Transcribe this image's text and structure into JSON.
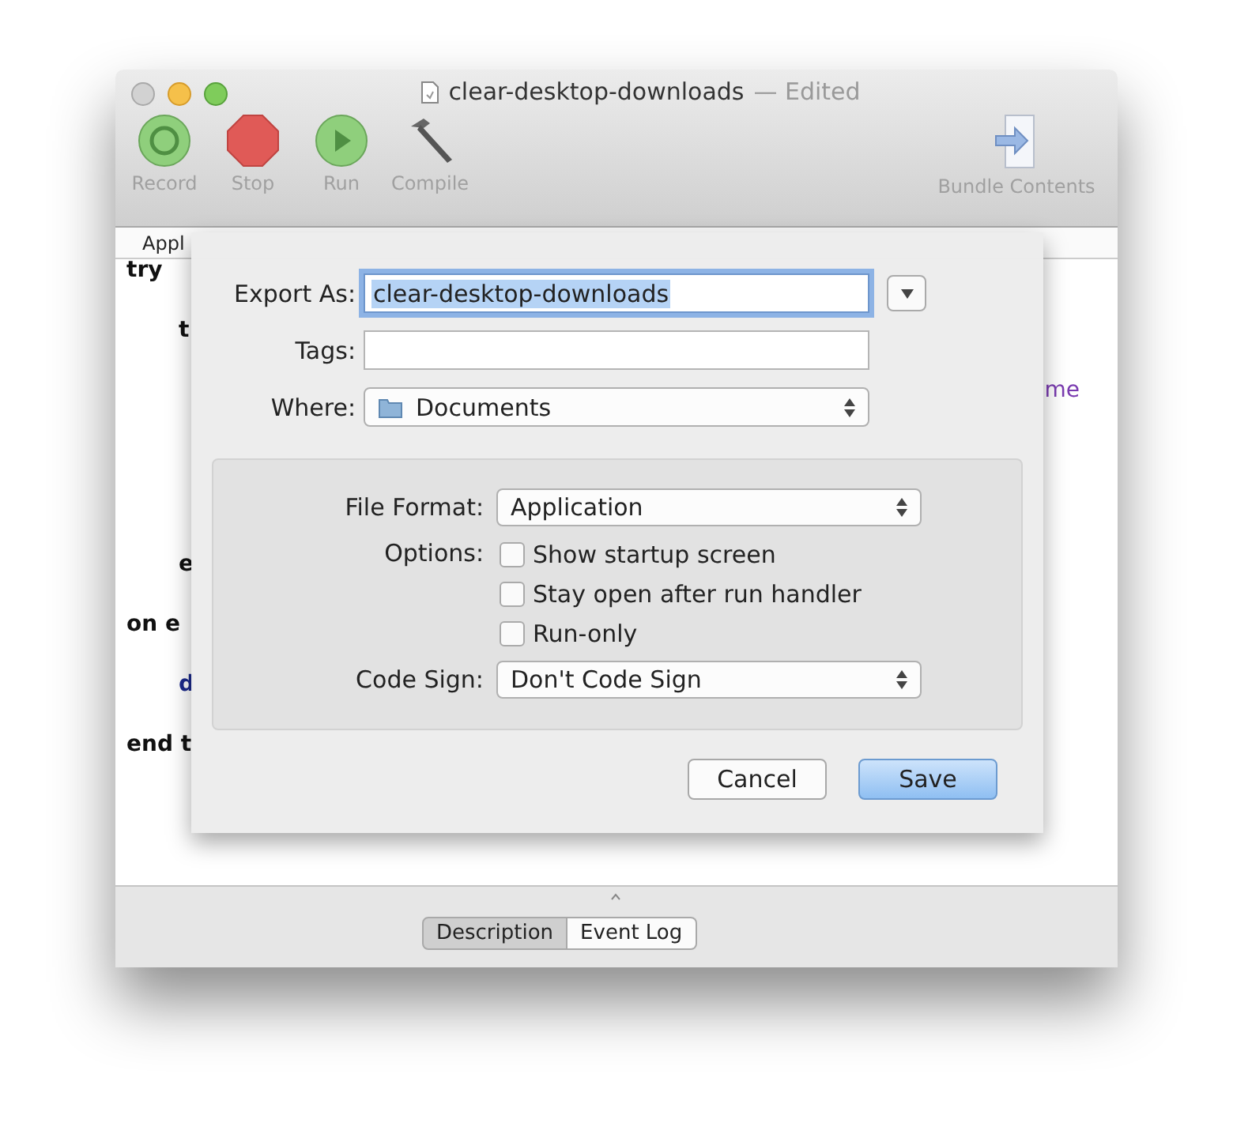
{
  "window": {
    "title": "clear-desktop-downloads",
    "status": "— Edited"
  },
  "toolbar": {
    "left": [
      {
        "label": "Record",
        "kind": "record"
      },
      {
        "label": "Stop",
        "kind": "stop"
      },
      {
        "label": "Run",
        "kind": "run"
      },
      {
        "label": "Compile",
        "kind": "compile"
      }
    ],
    "right": [
      {
        "label": "Bundle Contents",
        "kind": "bundle"
      }
    ]
  },
  "navigation_bar": {
    "text": "Appl"
  },
  "script": [
    {
      "text": "try",
      "kind": "keyword",
      "children": [
        {
          "text": "t",
          "kind": "keyword",
          "children": [
            {
              "text": "me",
              "kind": "variable",
              "tail": true
            }
          ]
        },
        {
          "text": "e",
          "kind": "keyword"
        }
      ]
    },
    {
      "text": "on e",
      "kind": "keyword",
      "children": [
        {
          "text": "d",
          "kind": "command"
        }
      ]
    },
    {
      "text": "end t",
      "kind": "keyword"
    }
  ],
  "save_sheet": {
    "export_as": {
      "label": "Export As:",
      "value": "clear-desktop-downloads",
      "text_selected": true
    },
    "tags": {
      "label": "Tags:"
    },
    "where": {
      "label": "Where:",
      "value": "Documents"
    },
    "file_format": {
      "label": "File Format:",
      "value": "Application"
    },
    "options": {
      "label": "Options:",
      "items": [
        {
          "label": "Show startup screen",
          "checked": false
        },
        {
          "label": "Stay open after run handler",
          "checked": false
        },
        {
          "label": "Run-only",
          "checked": false
        }
      ]
    },
    "code_sign": {
      "label": "Code Sign:",
      "value": "Don't Code Sign"
    },
    "buttons": [
      {
        "label": "Cancel",
        "default": false
      },
      {
        "label": "Save",
        "default": true
      }
    ]
  },
  "bottom_tabs": [
    {
      "label": "Description",
      "selected": true
    },
    {
      "label": "Event Log",
      "selected": false
    }
  ]
}
